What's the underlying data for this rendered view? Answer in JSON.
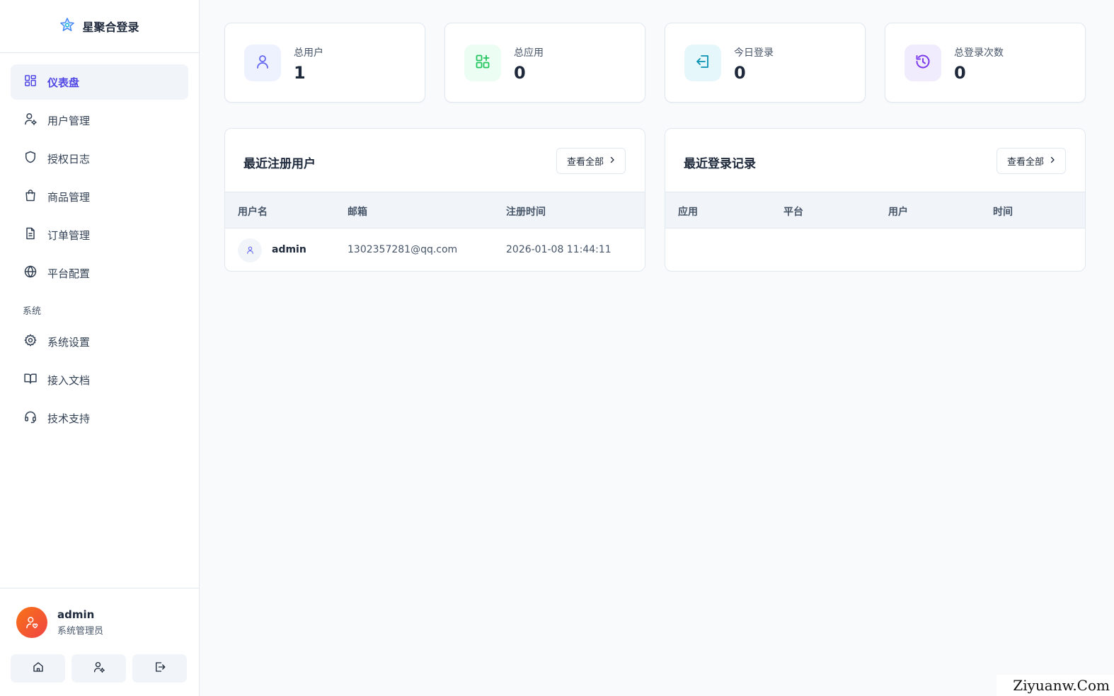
{
  "brand": {
    "name": "星聚合登录",
    "icon": "star-icon"
  },
  "sidebar": {
    "items": [
      {
        "label": "仪表盘",
        "icon": "dashboard-icon",
        "active": true
      },
      {
        "label": "用户管理",
        "icon": "user-gear-icon"
      },
      {
        "label": "授权日志",
        "icon": "shield-icon"
      },
      {
        "label": "商品管理",
        "icon": "shopping-bag-icon"
      },
      {
        "label": "订单管理",
        "icon": "document-icon"
      },
      {
        "label": "平台配置",
        "icon": "globe-icon"
      }
    ],
    "section_label": "系统",
    "system_items": [
      {
        "label": "系统设置",
        "icon": "gear-icon"
      },
      {
        "label": "接入文档",
        "icon": "book-icon"
      },
      {
        "label": "技术支持",
        "icon": "headset-icon"
      }
    ]
  },
  "user": {
    "name": "admin",
    "role": "系统管理员"
  },
  "footer_buttons": [
    "home-icon",
    "user-gear-icon",
    "logout-icon"
  ],
  "stats": [
    {
      "label": "总用户",
      "value": "1",
      "icon": "user-icon",
      "color": "#6366f1",
      "bg": "#eef2ff"
    },
    {
      "label": "总应用",
      "value": "0",
      "icon": "apps-add-icon",
      "color": "#22c55e",
      "bg": "#ecfdf3"
    },
    {
      "label": "今日登录",
      "value": "0",
      "icon": "login-icon",
      "color": "#0891b2",
      "bg": "#e6f7fb"
    },
    {
      "label": "总登录次数",
      "value": "0",
      "icon": "history-icon",
      "color": "#7c3aed",
      "bg": "#f1ecfd"
    }
  ],
  "recent_users": {
    "title": "最近注册用户",
    "view_all": "查看全部",
    "columns": [
      "用户名",
      "邮箱",
      "注册时间"
    ],
    "rows": [
      {
        "username": "admin",
        "email": "1302357281@qq.com",
        "registered": "2026-01-08 11:44:11"
      }
    ]
  },
  "recent_logins": {
    "title": "最近登录记录",
    "view_all": "查看全部",
    "columns": [
      "应用",
      "平台",
      "用户",
      "时间"
    ],
    "rows": []
  },
  "watermark": "Ziyuanw.Com"
}
